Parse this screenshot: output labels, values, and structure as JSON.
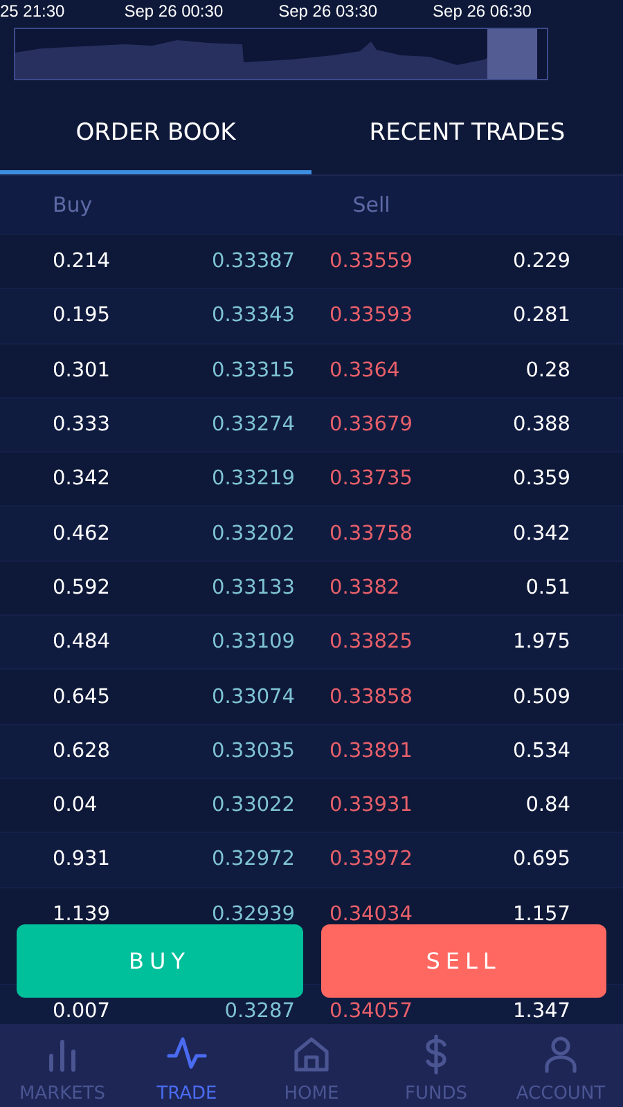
{
  "timeline": {
    "labels": [
      "25 21:30",
      "Sep 26 00:30",
      "Sep 26 03:30",
      "Sep 26 06:30"
    ]
  },
  "tabs": [
    {
      "label": "ORDER BOOK",
      "selected": true
    },
    {
      "label": "RECENT TRADES",
      "selected": false
    }
  ],
  "order_book": {
    "columns": [
      "Buy",
      "Sell"
    ],
    "rows": [
      {
        "buy_amount": "0.214",
        "buy_price": "0.33387",
        "sell_price": "0.33559",
        "sell_amount": "0.229"
      },
      {
        "buy_amount": "0.195",
        "buy_price": "0.33343",
        "sell_price": "0.33593",
        "sell_amount": "0.281"
      },
      {
        "buy_amount": "0.301",
        "buy_price": "0.33315",
        "sell_price": "0.3364",
        "sell_amount": "0.28"
      },
      {
        "buy_amount": "0.333",
        "buy_price": "0.33274",
        "sell_price": "0.33679",
        "sell_amount": "0.388"
      },
      {
        "buy_amount": "0.342",
        "buy_price": "0.33219",
        "sell_price": "0.33735",
        "sell_amount": "0.359"
      },
      {
        "buy_amount": "0.462",
        "buy_price": "0.33202",
        "sell_price": "0.33758",
        "sell_amount": "0.342"
      },
      {
        "buy_amount": "0.592",
        "buy_price": "0.33133",
        "sell_price": "0.3382",
        "sell_amount": "0.51"
      },
      {
        "buy_amount": "0.484",
        "buy_price": "0.33109",
        "sell_price": "0.33825",
        "sell_amount": "1.975"
      },
      {
        "buy_amount": "0.645",
        "buy_price": "0.33074",
        "sell_price": "0.33858",
        "sell_amount": "0.509"
      },
      {
        "buy_amount": "0.628",
        "buy_price": "0.33035",
        "sell_price": "0.33891",
        "sell_amount": "0.534"
      },
      {
        "buy_amount": "0.04",
        "buy_price": "0.33022",
        "sell_price": "0.33931",
        "sell_amount": "0.84"
      },
      {
        "buy_amount": "0.931",
        "buy_price": "0.32972",
        "sell_price": "0.33972",
        "sell_amount": "0.695"
      },
      {
        "buy_amount": "1.139",
        "buy_price": "0.32939",
        "sell_price": "0.34034",
        "sell_amount": "1.157"
      },
      {
        "buy_amount": "0.007",
        "buy_price": "0.3287",
        "sell_price": "0.34057",
        "sell_amount": "1.347"
      }
    ]
  },
  "actions": [
    {
      "label": "BUY",
      "kind": "buy"
    },
    {
      "label": "SELL",
      "kind": "sell"
    }
  ],
  "nav": [
    {
      "label": "MARKETS",
      "kind": "markets",
      "selected": false
    },
    {
      "label": "TRADE",
      "kind": "trade",
      "selected": true
    },
    {
      "label": "HOME",
      "kind": "home",
      "selected": false
    },
    {
      "label": "FUNDS",
      "kind": "funds",
      "selected": false
    },
    {
      "label": "ACCOUNT",
      "kind": "account",
      "selected": false
    }
  ]
}
